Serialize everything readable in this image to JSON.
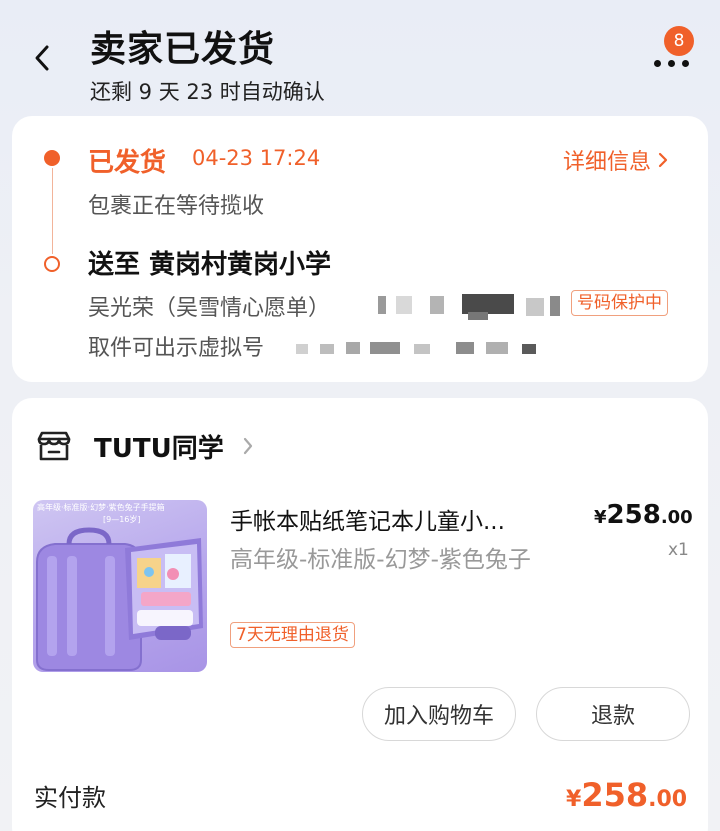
{
  "header": {
    "title": "卖家已发货",
    "subtitle": "还剩 9 天 23 时自动确认",
    "more_badge": "8"
  },
  "logistics": {
    "status": "已发货",
    "status_time": "04-23 17:24",
    "detail_link": "详细信息",
    "package_status": "包裹正在等待揽收",
    "deliver_to": "送至 黄岗村黄岗小学",
    "recipient": "吴光荣（吴雪情心愿单）",
    "privacy_tag": "号码保护中",
    "pickup_hint": "取件可出示虚拟号"
  },
  "shop": {
    "name": "TUTU同学"
  },
  "product": {
    "image_caption": "高年级·标准版·幻梦·紫色兔子手提箱",
    "image_age": "[9—16岁]",
    "title": "手帐本贴纸笔记本儿童小...",
    "price_currency": "¥",
    "price_int": "258",
    "price_dec": ".00",
    "quantity": "x1",
    "spec": "高年级-标准版-幻梦-紫色兔子",
    "return_tag": "7天无理由退货"
  },
  "actions": {
    "add_to_cart": "加入购物车",
    "refund": "退款"
  },
  "payment": {
    "label": "实付款",
    "currency": "¥",
    "amount_int": "258",
    "amount_dec": ".00"
  },
  "colors": {
    "accent": "#f0602a",
    "background": "#eef0f5"
  }
}
